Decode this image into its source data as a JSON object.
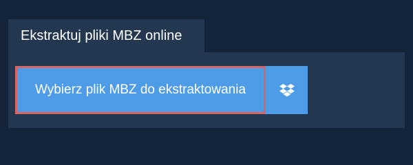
{
  "tab": {
    "title": "Ekstraktuj pliki MBZ online"
  },
  "upload": {
    "choose_label": "Wybierz plik MBZ do ekstraktowania",
    "dropbox_icon": "dropbox-icon"
  },
  "colors": {
    "background": "#13243b",
    "panel": "#233850",
    "button": "#4e9ce8",
    "focus_border": "#d86464",
    "text": "#ffffff"
  }
}
